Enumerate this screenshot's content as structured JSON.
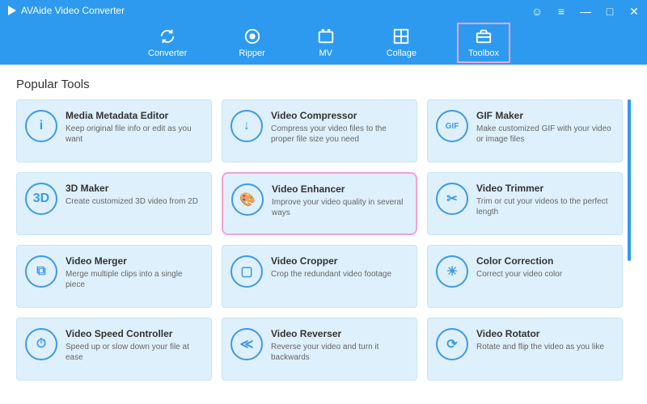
{
  "app_title": "AVAide Video Converter",
  "tabs": [
    {
      "id": "converter",
      "label": "Converter"
    },
    {
      "id": "ripper",
      "label": "Ripper"
    },
    {
      "id": "mv",
      "label": "MV"
    },
    {
      "id": "collage",
      "label": "Collage"
    },
    {
      "id": "toolbox",
      "label": "Toolbox"
    }
  ],
  "selected_tab": "toolbox",
  "section_title": "Popular Tools",
  "tools": [
    {
      "icon": "i",
      "title": "Media Metadata Editor",
      "desc": "Keep original file info or edit as you want"
    },
    {
      "icon": "↓",
      "title": "Video Compressor",
      "desc": "Compress your video files to the proper file size you need"
    },
    {
      "icon": "GIF",
      "title": "GIF Maker",
      "desc": "Make customized GIF with your video or image files"
    },
    {
      "icon": "3D",
      "title": "3D Maker",
      "desc": "Create customized 3D video from 2D"
    },
    {
      "icon": "🎨",
      "title": "Video Enhancer",
      "desc": "Improve your video quality in several ways",
      "hl": true
    },
    {
      "icon": "✂",
      "title": "Video Trimmer",
      "desc": "Trim or cut your videos to the perfect length"
    },
    {
      "icon": "⧉",
      "title": "Video Merger",
      "desc": "Merge multiple clips into a single piece"
    },
    {
      "icon": "▢",
      "title": "Video Cropper",
      "desc": "Crop the redundant video footage"
    },
    {
      "icon": "☀",
      "title": "Color Correction",
      "desc": "Correct your video color"
    },
    {
      "icon": "⏱",
      "title": "Video Speed Controller",
      "desc": "Speed up or slow down your file at ease"
    },
    {
      "icon": "≪",
      "title": "Video Reverser",
      "desc": "Reverse your video and turn it backwards"
    },
    {
      "icon": "⟳",
      "title": "Video Rotator",
      "desc": "Rotate and flip the video as you like"
    }
  ]
}
